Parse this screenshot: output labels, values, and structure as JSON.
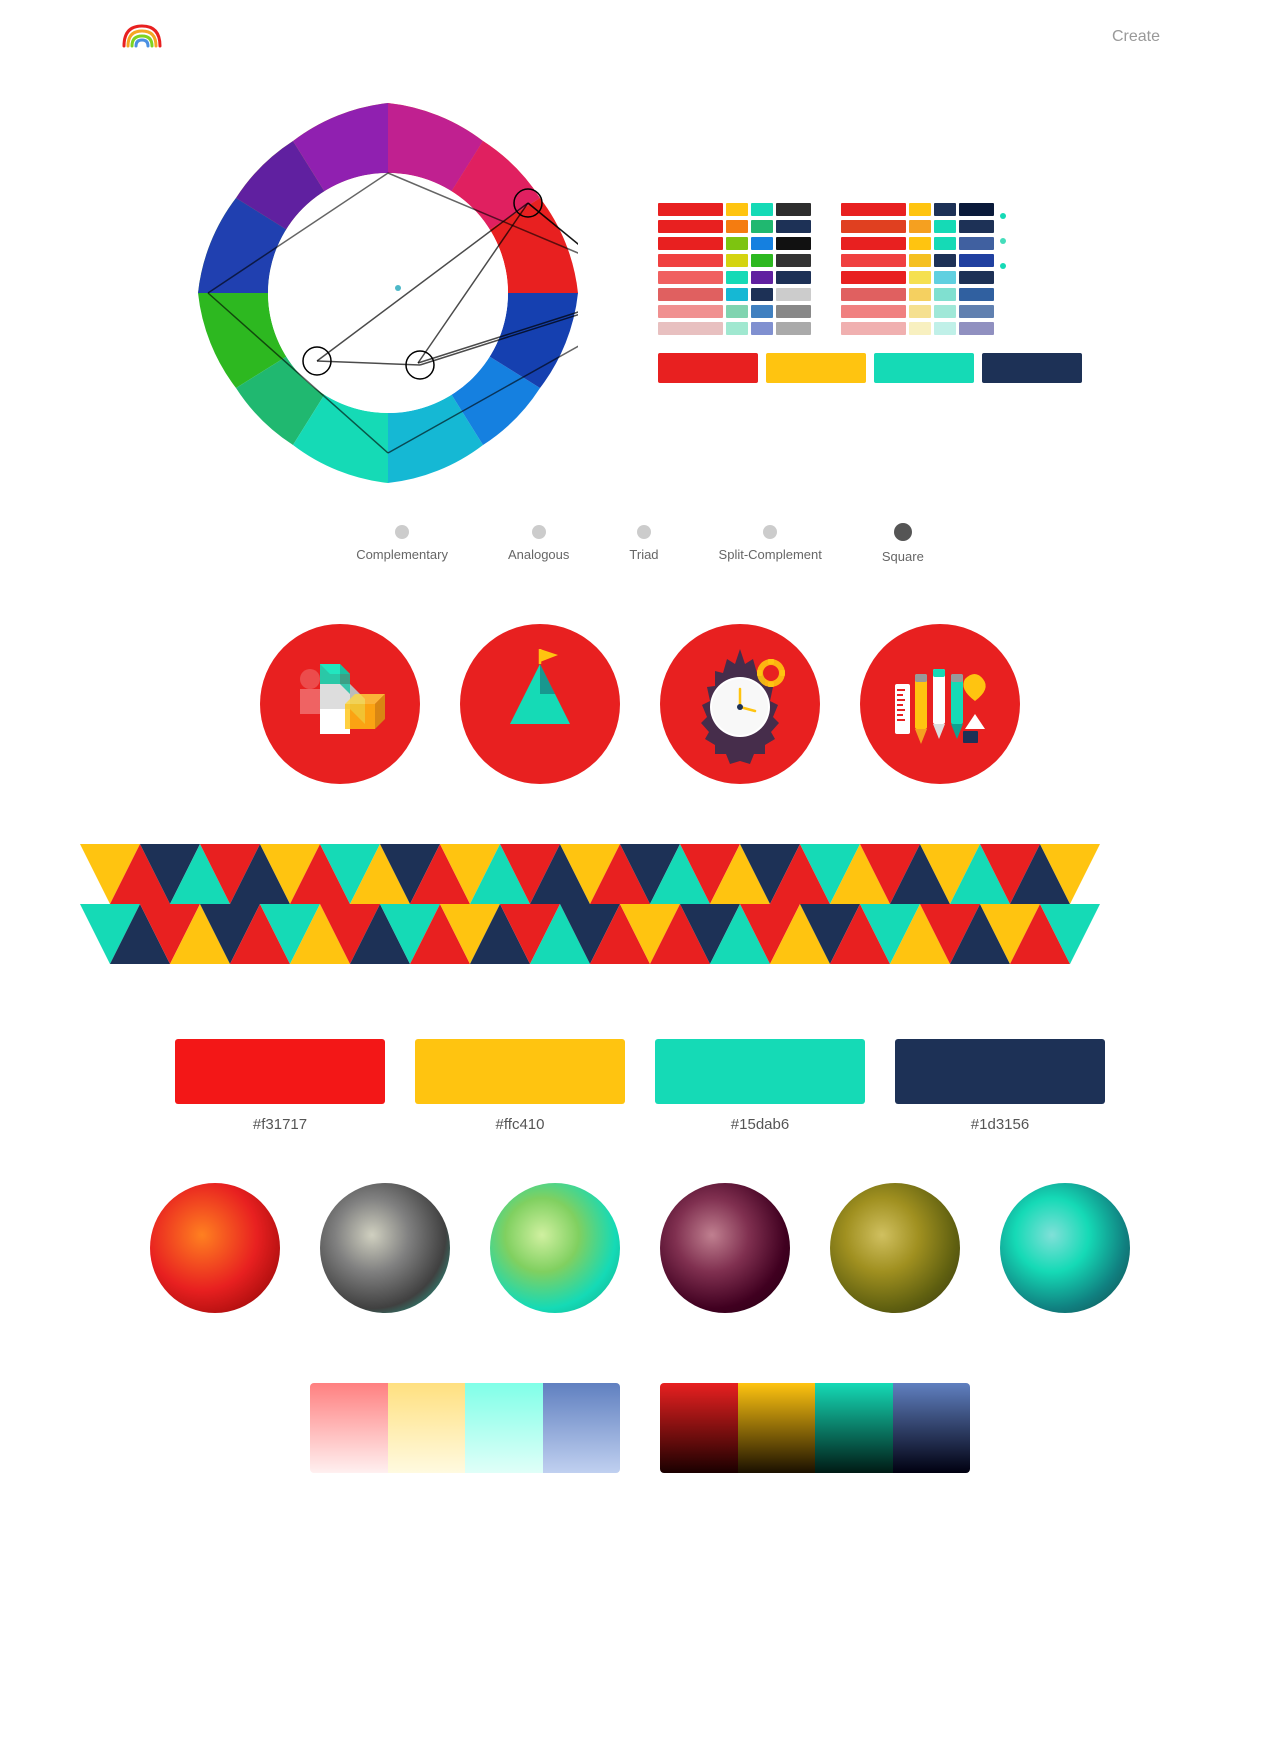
{
  "header": {
    "create_label": "Create"
  },
  "modes": [
    {
      "label": "Complementary",
      "active": false
    },
    {
      "label": "Analogous",
      "active": false
    },
    {
      "label": "Triad",
      "active": false
    },
    {
      "label": "Split-Complement",
      "active": false
    },
    {
      "label": "Square",
      "active": true
    }
  ],
  "colors": {
    "red": "#f31717",
    "yellow": "#ffc410",
    "teal": "#15dab6",
    "navy": "#1d3156",
    "red_label": "#f31717",
    "yellow_label": "#ffc410",
    "teal_label": "#15dab6",
    "navy_label": "#1d3156"
  },
  "hex_labels": [
    "#f31717",
    "#ffc410",
    "#15dab6",
    "#1d3156"
  ]
}
